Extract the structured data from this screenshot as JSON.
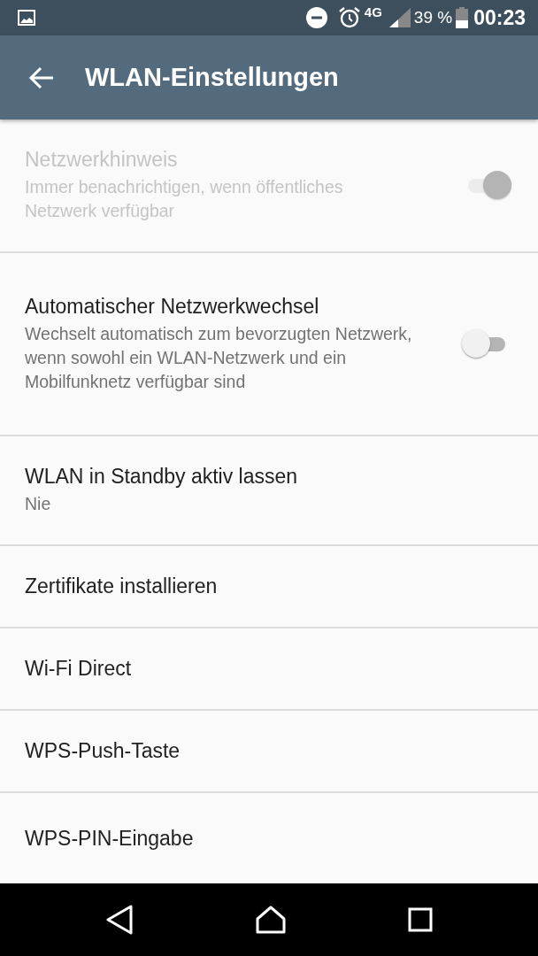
{
  "status_bar": {
    "network": "4G",
    "battery": "39 %",
    "time": "00:23"
  },
  "app_bar": {
    "title": "WLAN-Einstellungen"
  },
  "settings": [
    {
      "kind": "switch",
      "title": "Netzwerkhinweis",
      "summary": "Immer benachrichtigen, wenn öffentliches Netzwerk verfügbar",
      "on": true,
      "disabled": true
    },
    {
      "kind": "switch",
      "title": "Automatischer Netzwerkwechsel",
      "summary": "Wechselt automatisch zum bevorzugten Netzwerk, wenn sowohl ein WLAN-Netzwerk und ein Mobilfunknetz verfügbar sind",
      "on": false,
      "disabled": false
    },
    {
      "kind": "plain",
      "title": "WLAN in Standby aktiv lassen",
      "summary": "Nie"
    },
    {
      "kind": "plain",
      "title": "Zertifikate installieren"
    },
    {
      "kind": "plain",
      "title": "Wi-Fi Direct"
    },
    {
      "kind": "plain",
      "title": "WPS-Push-Taste"
    },
    {
      "kind": "plain",
      "title": "WPS-PIN-Eingabe"
    }
  ]
}
